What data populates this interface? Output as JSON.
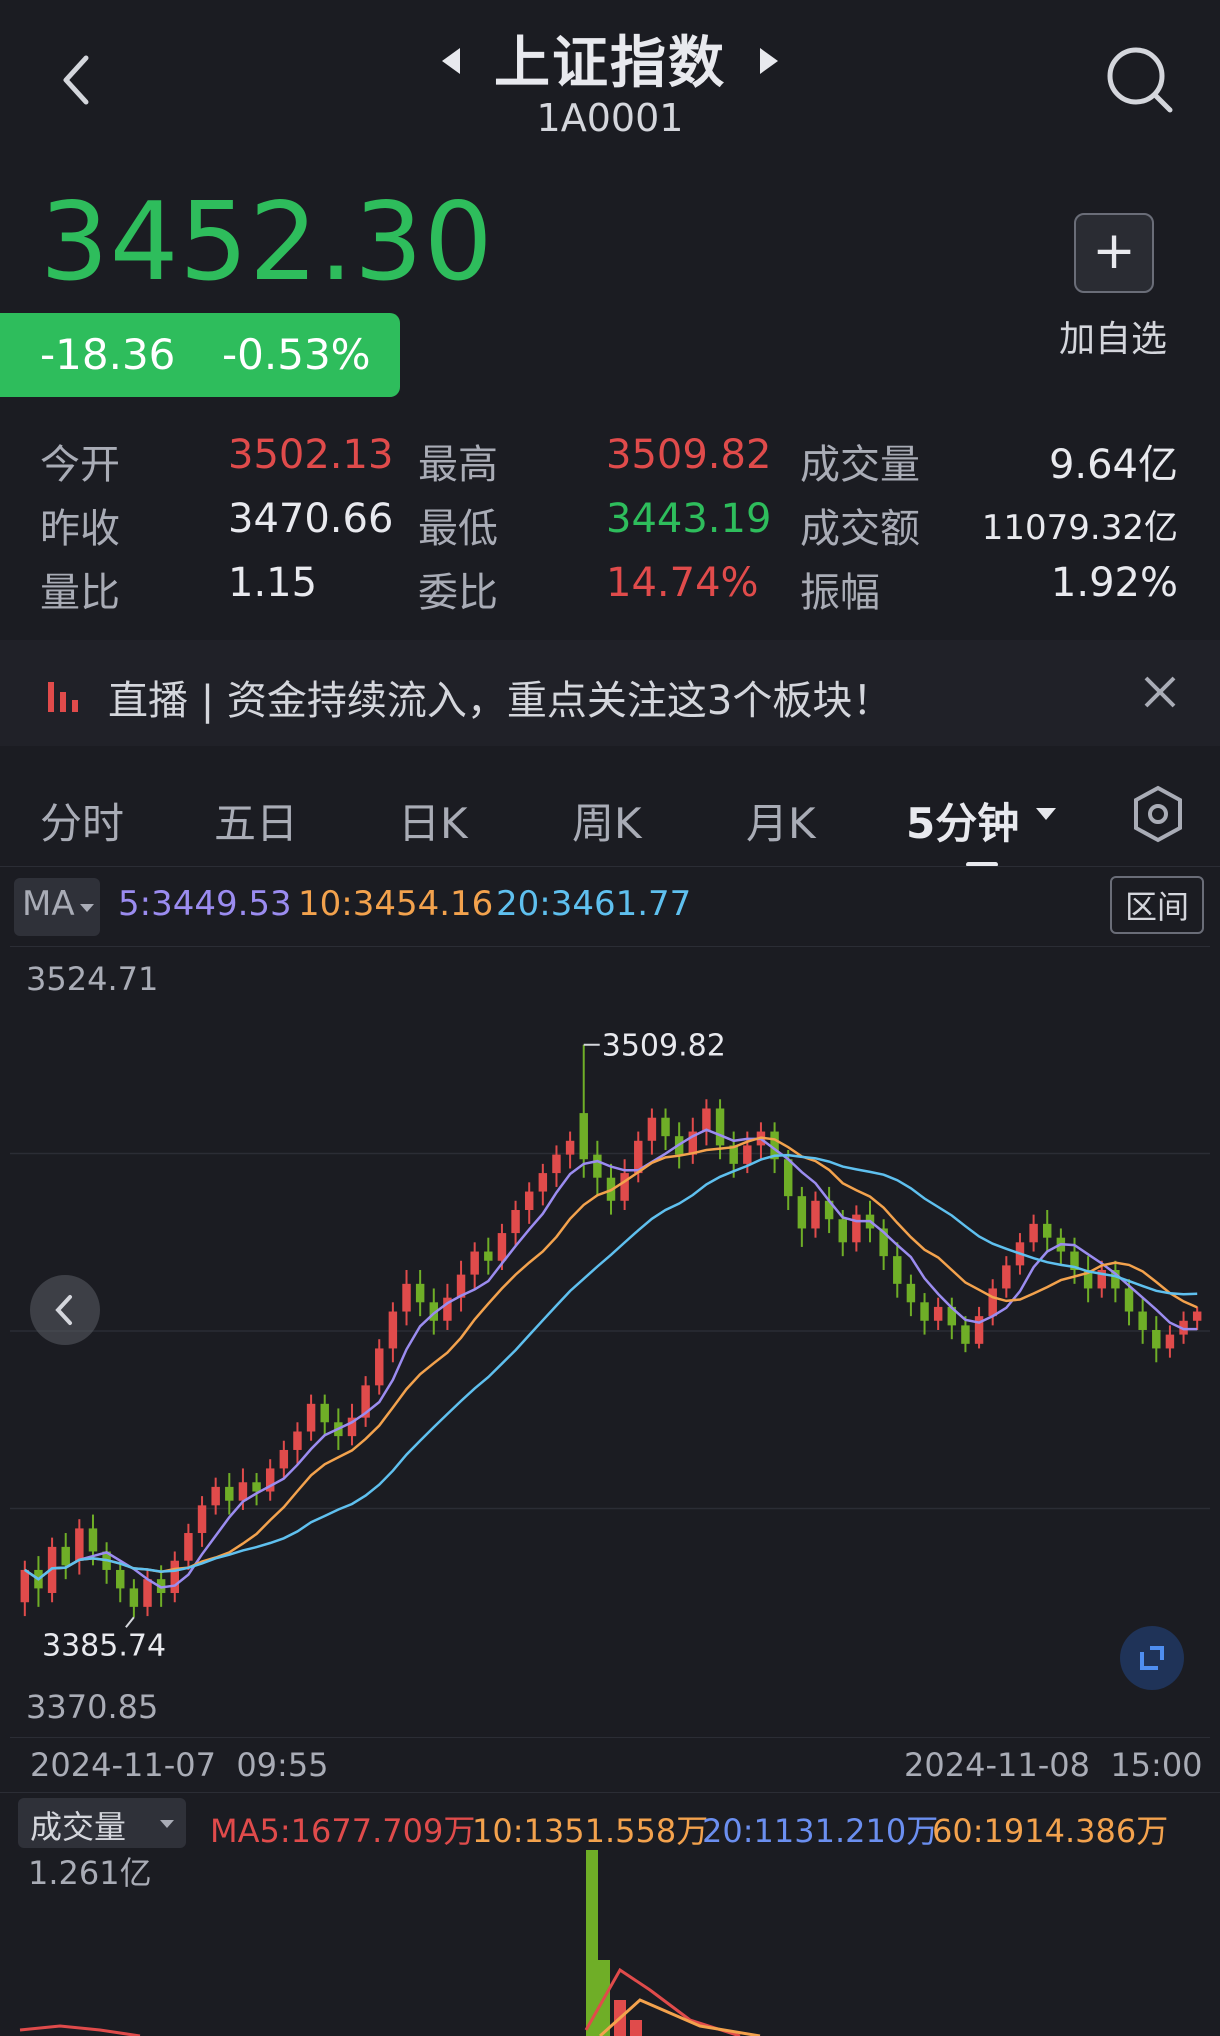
{
  "header": {
    "title": "上证指数",
    "code": "1A0001"
  },
  "quote": {
    "price": "3452.30",
    "change": "-18.36",
    "change_pct": "-0.53%",
    "add_label": "加自选"
  },
  "stats": [
    {
      "label": "今开",
      "value": "3502.13",
      "color": "red"
    },
    {
      "label": "最高",
      "value": "3509.82",
      "color": "red"
    },
    {
      "label": "成交量",
      "value": "9.64亿",
      "color": "wht"
    },
    {
      "label": "昨收",
      "value": "3470.66",
      "color": "wht"
    },
    {
      "label": "最低",
      "value": "3443.19",
      "color": "grn"
    },
    {
      "label": "成交额",
      "value": "11079.32亿",
      "color": "wht"
    },
    {
      "label": "量比",
      "value": "1.15",
      "color": "wht"
    },
    {
      "label": "委比",
      "value": "14.74%",
      "color": "red"
    },
    {
      "label": "振幅",
      "value": "1.92%",
      "color": "wht"
    }
  ],
  "news": {
    "text": "直播 | 资金持续流入，重点关注这3个板块！"
  },
  "tabs": [
    "分时",
    "五日",
    "日K",
    "周K",
    "月K",
    "5分钟"
  ],
  "ma": {
    "selector": "MA",
    "ma5": "5:3449.53",
    "ma10": "10:3454.16",
    "ma20": "20:3461.77",
    "range_button": "区间"
  },
  "chart_labels": {
    "ymax": "3524.71",
    "ymin": "3370.85",
    "high_mark": "3509.82",
    "low_mark": "3385.74",
    "start_time": "2024-11-07  09:55",
    "end_time": "2024-11-08  15:00"
  },
  "volume": {
    "selector": "成交量",
    "ma5": "MA5:1677.709万",
    "ma10": "10:1351.558万",
    "ma20": "20:1131.210万",
    "ma60": "60:1914.386万",
    "ymax": "1.261亿"
  },
  "colors": {
    "up": "#e04b4b",
    "down": "#6fae27",
    "ma5": "#9b8cf0",
    "ma10": "#f3a24d",
    "ma20": "#5fc0ef",
    "bg": "#1b1c22"
  },
  "chart_data": {
    "type": "candlestick",
    "interval": "5分钟",
    "ylim": [
      3370.85,
      3524.71
    ],
    "x_range": [
      "2024-11-07 09:55",
      "2024-11-08 15:00"
    ],
    "high": 3509.82,
    "low": 3385.74,
    "candles": [
      [
        3389,
        3396,
        3386,
        3398
      ],
      [
        3396,
        3392,
        3388,
        3399
      ],
      [
        3391,
        3401,
        3389,
        3403
      ],
      [
        3401,
        3397,
        3394,
        3404
      ],
      [
        3398,
        3405,
        3395,
        3407
      ],
      [
        3405,
        3400,
        3397,
        3408
      ],
      [
        3400,
        3396,
        3393,
        3402
      ],
      [
        3396,
        3392,
        3389,
        3398
      ],
      [
        3392,
        3388,
        3385.74,
        3394
      ],
      [
        3388,
        3394,
        3386,
        3396
      ],
      [
        3394,
        3391,
        3388,
        3397
      ],
      [
        3391,
        3398,
        3389,
        3400
      ],
      [
        3398,
        3404,
        3396,
        3406
      ],
      [
        3404,
        3410,
        3401,
        3412
      ],
      [
        3410,
        3414,
        3408,
        3416
      ],
      [
        3414,
        3411,
        3408,
        3417
      ],
      [
        3411,
        3415,
        3409,
        3418
      ],
      [
        3415,
        3413,
        3410,
        3417
      ],
      [
        3413,
        3418,
        3411,
        3420
      ],
      [
        3418,
        3422,
        3416,
        3424
      ],
      [
        3422,
        3426,
        3419,
        3428
      ],
      [
        3426,
        3432,
        3424,
        3434
      ],
      [
        3432,
        3428,
        3425,
        3434
      ],
      [
        3428,
        3425,
        3422,
        3431
      ],
      [
        3425,
        3429,
        3423,
        3432
      ],
      [
        3429,
        3436,
        3427,
        3438
      ],
      [
        3436,
        3444,
        3434,
        3446
      ],
      [
        3444,
        3452,
        3441,
        3454
      ],
      [
        3452,
        3458,
        3449,
        3461
      ],
      [
        3458,
        3454,
        3451,
        3461
      ],
      [
        3454,
        3450,
        3447,
        3457
      ],
      [
        3450,
        3455,
        3448,
        3458
      ],
      [
        3455,
        3460,
        3452,
        3463
      ],
      [
        3460,
        3465,
        3457,
        3467
      ],
      [
        3465,
        3463,
        3460,
        3468
      ],
      [
        3463,
        3469,
        3461,
        3471
      ],
      [
        3469,
        3474,
        3466,
        3476
      ],
      [
        3474,
        3478,
        3471,
        3480
      ],
      [
        3478,
        3482,
        3475,
        3484
      ],
      [
        3482,
        3486,
        3479,
        3488
      ],
      [
        3486,
        3489,
        3483,
        3491
      ],
      [
        3495,
        3485,
        3481,
        3509.82
      ],
      [
        3486,
        3481,
        3477,
        3489
      ],
      [
        3481,
        3476,
        3473,
        3484
      ],
      [
        3476,
        3482,
        3474,
        3485
      ],
      [
        3482,
        3489,
        3480,
        3491
      ],
      [
        3489,
        3494,
        3486,
        3496
      ],
      [
        3494,
        3490,
        3487,
        3496
      ],
      [
        3490,
        3486,
        3483,
        3493
      ],
      [
        3486,
        3491,
        3484,
        3494
      ],
      [
        3491,
        3496,
        3488,
        3498
      ],
      [
        3496,
        3488,
        3485,
        3498
      ],
      [
        3488,
        3484,
        3481,
        3491
      ],
      [
        3484,
        3488,
        3482,
        3491
      ],
      [
        3488,
        3491,
        3485,
        3493
      ],
      [
        3491,
        3485,
        3482,
        3493
      ],
      [
        3485,
        3477,
        3474,
        3487
      ],
      [
        3477,
        3470,
        3466,
        3479
      ],
      [
        3470,
        3476,
        3468,
        3478
      ],
      [
        3476,
        3472,
        3469,
        3479
      ],
      [
        3472,
        3467,
        3464,
        3474
      ],
      [
        3467,
        3473,
        3465,
        3475
      ],
      [
        3473,
        3470,
        3467,
        3476
      ],
      [
        3470,
        3464,
        3461,
        3472
      ],
      [
        3464,
        3458,
        3455,
        3467
      ],
      [
        3458,
        3454,
        3451,
        3460
      ],
      [
        3454,
        3450,
        3447,
        3456
      ],
      [
        3450,
        3453,
        3448,
        3455
      ],
      [
        3453,
        3449,
        3446,
        3455
      ],
      [
        3449,
        3445,
        3443.19,
        3451
      ],
      [
        3445,
        3451,
        3444,
        3453
      ],
      [
        3451,
        3457,
        3449,
        3459
      ],
      [
        3457,
        3462,
        3455,
        3464
      ],
      [
        3462,
        3467,
        3460,
        3469
      ],
      [
        3467,
        3471,
        3465,
        3473
      ],
      [
        3471,
        3468,
        3465,
        3474
      ],
      [
        3468,
        3465,
        3462,
        3470
      ],
      [
        3465,
        3461,
        3458,
        3468
      ],
      [
        3461,
        3457,
        3454,
        3464
      ],
      [
        3457,
        3461,
        3455,
        3463
      ],
      [
        3461,
        3457,
        3454,
        3463
      ],
      [
        3457,
        3452,
        3449,
        3459
      ],
      [
        3452,
        3448,
        3445,
        3455
      ],
      [
        3448,
        3444,
        3441,
        3451
      ],
      [
        3444,
        3447,
        3442,
        3449
      ],
      [
        3447,
        3450,
        3445,
        3452
      ],
      [
        3450,
        3452,
        3448,
        3453
      ]
    ]
  }
}
